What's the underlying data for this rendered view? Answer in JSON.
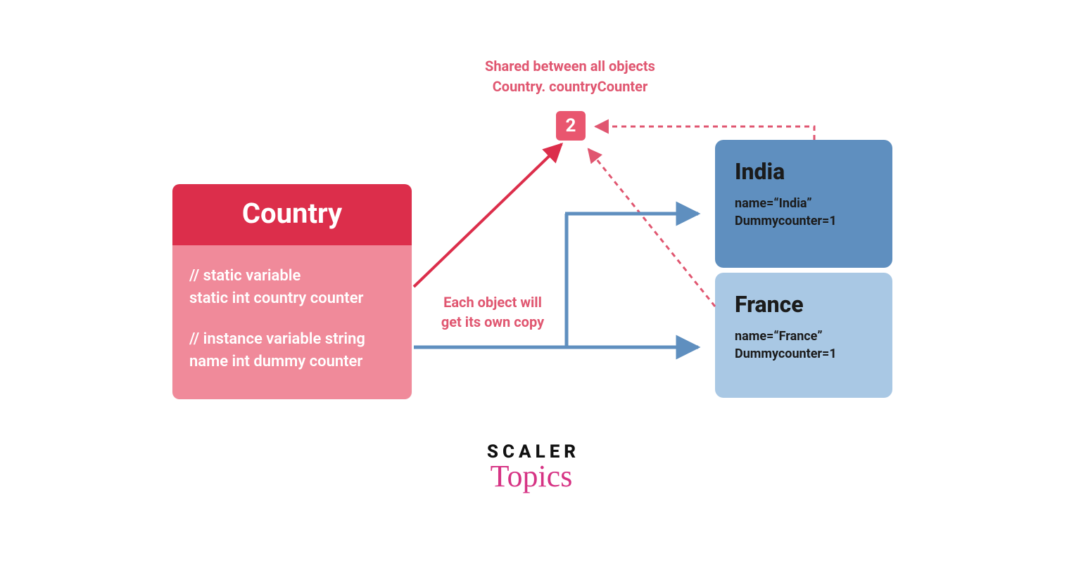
{
  "sharedLabel": {
    "line1": "Shared between all objects",
    "line2": "Country. countryCounter"
  },
  "counterValue": "2",
  "countryClass": {
    "title": "Country",
    "line1": "// static variable",
    "line2": "static int country counter",
    "line3": "// instance variable string",
    "line4": "name int dummy counter"
  },
  "eachCopy": {
    "line1": "Each object will",
    "line2": "get its own copy"
  },
  "objects": {
    "india": {
      "title": "India",
      "nameLine": "name=“India”",
      "dummyLine": "Dummycounter=1"
    },
    "france": {
      "title": "France",
      "nameLine": "name=“France”",
      "dummyLine": "Dummycounter=1"
    }
  },
  "logo": {
    "top": "SCALER",
    "script": "Topics"
  },
  "colors": {
    "red": "#dc2e4b",
    "pink": "#f08a9a",
    "rose": "#e05670",
    "blue": "#5f8fbf",
    "lightblue": "#a9c8e4"
  }
}
